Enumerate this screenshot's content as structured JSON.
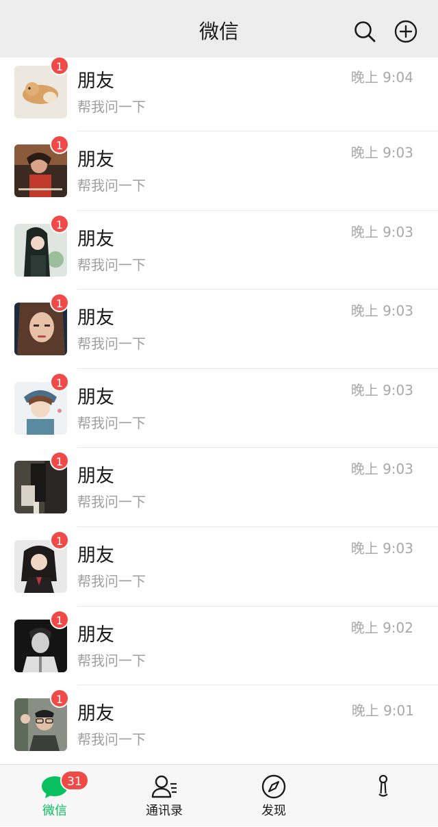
{
  "header": {
    "title": "微信",
    "search_icon": "search-icon",
    "add_icon": "plus-circle-icon"
  },
  "chats": [
    {
      "name": "朋友",
      "preview": "帮我问一下",
      "time": "晚上 9:04",
      "unread": "1"
    },
    {
      "name": "朋友",
      "preview": "帮我问一下",
      "time": "晚上 9:03",
      "unread": "1"
    },
    {
      "name": "朋友",
      "preview": "帮我问一下",
      "time": "晚上 9:03",
      "unread": "1"
    },
    {
      "name": "朋友",
      "preview": "帮我问一下",
      "time": "晚上 9:03",
      "unread": "1"
    },
    {
      "name": "朋友",
      "preview": "帮我问一下",
      "time": "晚上 9:03",
      "unread": "1"
    },
    {
      "name": "朋友",
      "preview": "帮我问一下",
      "time": "晚上 9:03",
      "unread": "1"
    },
    {
      "name": "朋友",
      "preview": "帮我问一下",
      "time": "晚上 9:03",
      "unread": "1"
    },
    {
      "name": "朋友",
      "preview": "帮我问一下",
      "time": "晚上 9:02",
      "unread": "1"
    },
    {
      "name": "朋友",
      "preview": "帮我问一下",
      "time": "晚上 9:01",
      "unread": "1"
    }
  ],
  "tabbar": {
    "chats": {
      "label": "微信",
      "badge": "31",
      "icon": "chat-bubble-icon"
    },
    "contacts": {
      "label": "通讯录",
      "icon": "contacts-icon"
    },
    "discover": {
      "label": "发现",
      "icon": "compass-icon"
    },
    "me": {
      "label": "",
      "icon": "person-icon"
    }
  },
  "colors": {
    "accent": "#07c160",
    "badge": "#f04a48",
    "header_bg": "#ededed",
    "tabbar_bg": "#f7f7f7"
  }
}
